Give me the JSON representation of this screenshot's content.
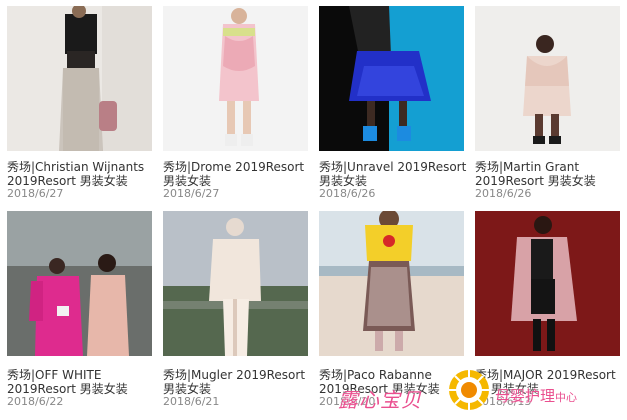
{
  "cards": [
    {
      "title": "秀场|Christian Wijnants 2019Resort 男装女装",
      "date": "2018/6/27"
    },
    {
      "title": "秀场|Drome 2019Resort 男装女装",
      "date": "2018/6/27"
    },
    {
      "title": "秀场|Unravel 2019Resort 男装女装",
      "date": "2018/6/26"
    },
    {
      "title": "秀场|Martin Grant 2019Resort 男装女装",
      "date": "2018/6/26"
    },
    {
      "title": "秀场|OFF WHITE 2019Resort 男装女装",
      "date": "2018/6/22"
    },
    {
      "title": "秀场|Mugler 2019Resort 男装女装",
      "date": "2018/6/21"
    },
    {
      "title": "秀场|Paco Rabanne 2019Resort 男装女装",
      "date": "2018/6/20"
    },
    {
      "title": "秀场|MAJOR 2019Resort巴 男装女装",
      "date": "2018/6/13"
    }
  ],
  "watermark": {
    "left_text": "露心宝贝",
    "right_text": "母婴护理",
    "right_small": "中心"
  },
  "colors": {
    "title": "#333333",
    "date": "#888888",
    "watermark": "#ea4f8f"
  }
}
